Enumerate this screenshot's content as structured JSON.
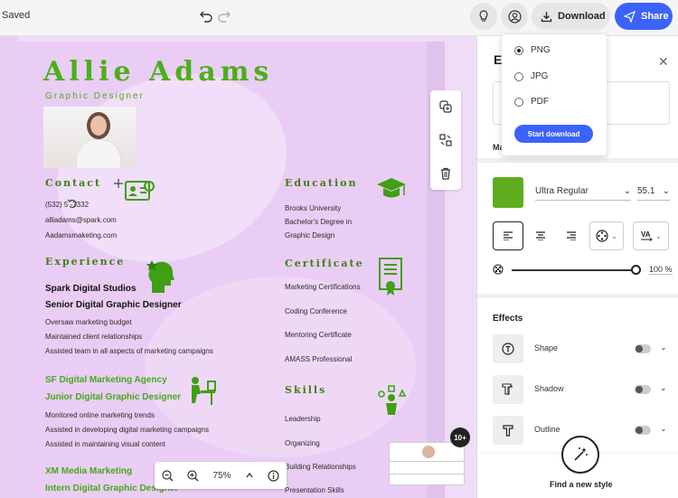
{
  "topbar": {
    "status": "Saved",
    "download_label": "Download",
    "share_label": "Share",
    "icons": [
      "undo-icon",
      "redo-icon",
      "lightbulb-icon",
      "account-icon",
      "download-icon",
      "send-icon"
    ]
  },
  "download_menu": {
    "options": [
      {
        "label": "PNG",
        "selected": true
      },
      {
        "label": "JPG",
        "selected": false
      },
      {
        "label": "PDF",
        "selected": false
      }
    ],
    "start_label": "Start download"
  },
  "resume": {
    "name": "Allie Adams",
    "role": "Graphic Designer",
    "contact": {
      "heading": "Contact",
      "phone": "(532) 5  -7332",
      "email": "alliadams@spark.com",
      "site": "Aadamsmaketing.com"
    },
    "education": {
      "heading": "Education",
      "lines": [
        "Brooks University",
        "Bachelor's Degree in",
        "Graphic Design"
      ]
    },
    "experience": {
      "heading": "Experience",
      "jobs": [
        {
          "company": "Spark Digital Studios",
          "title": "Senior Digital Graphic Designer",
          "bullets": [
            "Oversaw marketing budget",
            "Maintained client relationships",
            "Assisted team in all aspects of marketing campaigns"
          ]
        },
        {
          "company": "SF Digital Marketing Agency",
          "title": "Junior Digital Graphic Designer",
          "bullets": [
            "Monitored online marketing trends",
            "Assisted in developing digital marketing campaigns",
            "Assisted in maintaining visual content"
          ]
        },
        {
          "company": "XM Media Marketing",
          "title": "Intern Digital Graphic Designer",
          "bullets": []
        }
      ]
    },
    "certificate": {
      "heading": "Certificate",
      "items": [
        "Marketing Certifications",
        "Coding Conference",
        "Mentoring Certificate",
        "AMASS Professional"
      ]
    },
    "skills": {
      "heading": "Skills",
      "items": [
        "Leadership",
        "Organizing",
        "Building Relationships",
        "Presentation Skills"
      ]
    }
  },
  "zoom": {
    "value": "75%"
  },
  "pages_badge": "10+",
  "panel": {
    "title": "Ed",
    "subheading": "Ma",
    "color": "#5fad1e",
    "font": "Ultra Regular",
    "size": "55.1",
    "opacity": "100 %",
    "effects_title": "Effects",
    "effects": [
      {
        "label": "Shape",
        "icon": "shape-icon"
      },
      {
        "label": "Shadow",
        "icon": "shadow-icon"
      },
      {
        "label": "Outline",
        "icon": "outline-icon"
      }
    ],
    "new_style_label": "Find a new style"
  }
}
